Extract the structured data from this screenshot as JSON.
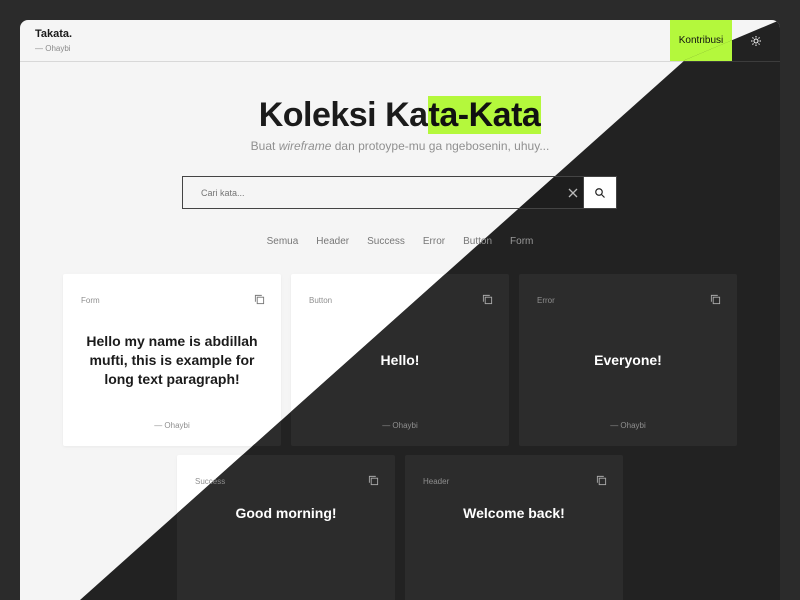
{
  "header": {
    "brand": "Takata.",
    "author": "— Ohaybi",
    "contribute_label": "Kontribusi",
    "theme_icon": "sun-icon"
  },
  "hero": {
    "title_plain": "Koleksi Ka",
    "title_highlight": "ta-Kata",
    "subtitle_pre": "Buat ",
    "subtitle_em": "wireframe",
    "subtitle_post": " dan protoype-mu ga ngebosenin, uhuy..."
  },
  "search": {
    "placeholder": "Cari kata...",
    "value": "",
    "clear_icon": "close-icon",
    "search_icon": "search-icon"
  },
  "filters": [
    "Semua",
    "Header",
    "Success",
    "Error",
    "Button",
    "Form"
  ],
  "cards": [
    {
      "category": "Form",
      "text": "Hello my name is abdillah mufti, this is example for long text paragraph!",
      "author": "— Ohaybi"
    },
    {
      "category": "Button",
      "text": "Hello!",
      "author": "— Ohaybi"
    },
    {
      "category": "Error",
      "text": "Everyone!",
      "author": "— Ohaybi"
    },
    {
      "category": "Success",
      "text": "Good morning!",
      "author": ""
    },
    {
      "category": "Header",
      "text": "Welcome back!",
      "author": ""
    }
  ],
  "colors": {
    "accent": "#b4f83c",
    "dark_bg": "#222222",
    "light_bg": "#f5f5f5",
    "outer_bg": "#2b2b2b"
  }
}
